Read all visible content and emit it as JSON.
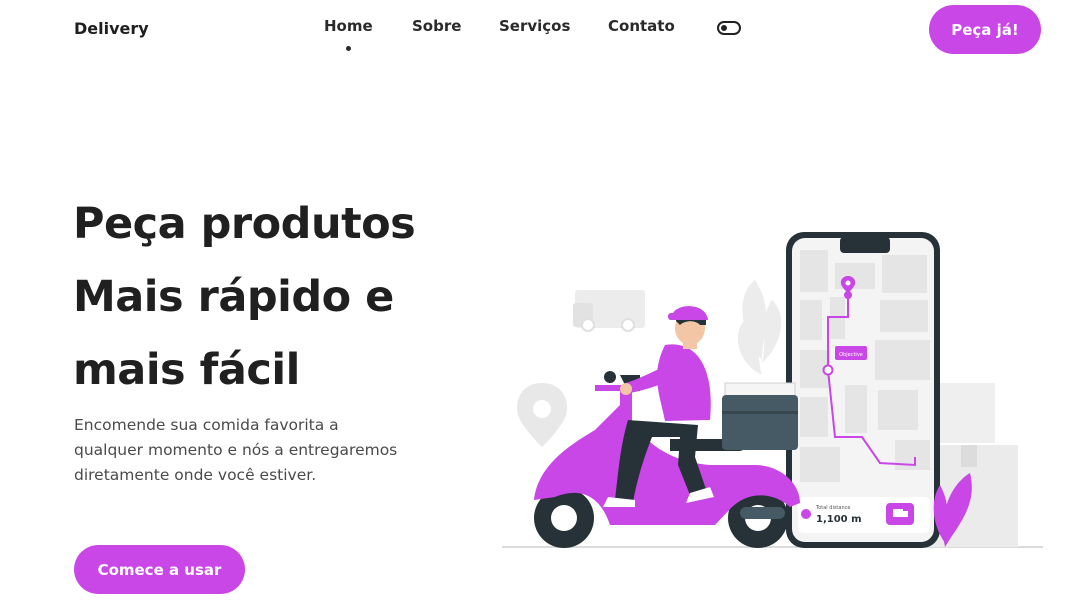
{
  "nav": {
    "logo": "Delivery",
    "links": [
      {
        "label": "Home"
      },
      {
        "label": "Sobre"
      },
      {
        "label": "Serviços"
      },
      {
        "label": "Contato"
      }
    ],
    "cta_label": "Peça já!"
  },
  "hero": {
    "title_lines": [
      "Peça produtos",
      "Mais rápido e",
      "mais fácil"
    ],
    "description": "Encomende sua comida favorita a qualquer momento e nós a entregaremos diretamente onde você estiver.",
    "cta_label": "Comece a usar"
  },
  "illustration": {
    "map_pin_label": "Objective",
    "distance_label": "Total distance",
    "distance_value": "1,100 m"
  },
  "colors": {
    "accent": "#c847e6",
    "text": "#202020"
  }
}
